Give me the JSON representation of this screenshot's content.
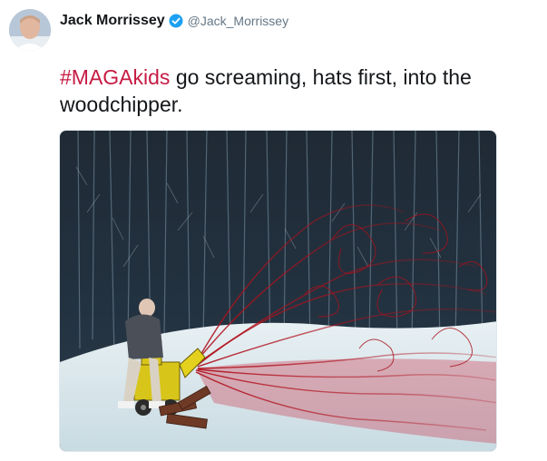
{
  "tweet": {
    "author_name": "Jack Morrissey",
    "handle": "@Jack_Morrissey",
    "verified": true,
    "hashtag": "#MAGAkids",
    "text_after_hashtag": " go screaming, hats first, into the woodchipper."
  },
  "media": {
    "image_subject": "painting of a person feeding a yellow woodchipper in a snowy dark forest, spraying red lines"
  },
  "colors": {
    "hashtag": "#c61b43",
    "verified_badge": "#1da1f2",
    "handle": "#657786"
  },
  "icons": {
    "verified": "verified-badge-icon"
  }
}
